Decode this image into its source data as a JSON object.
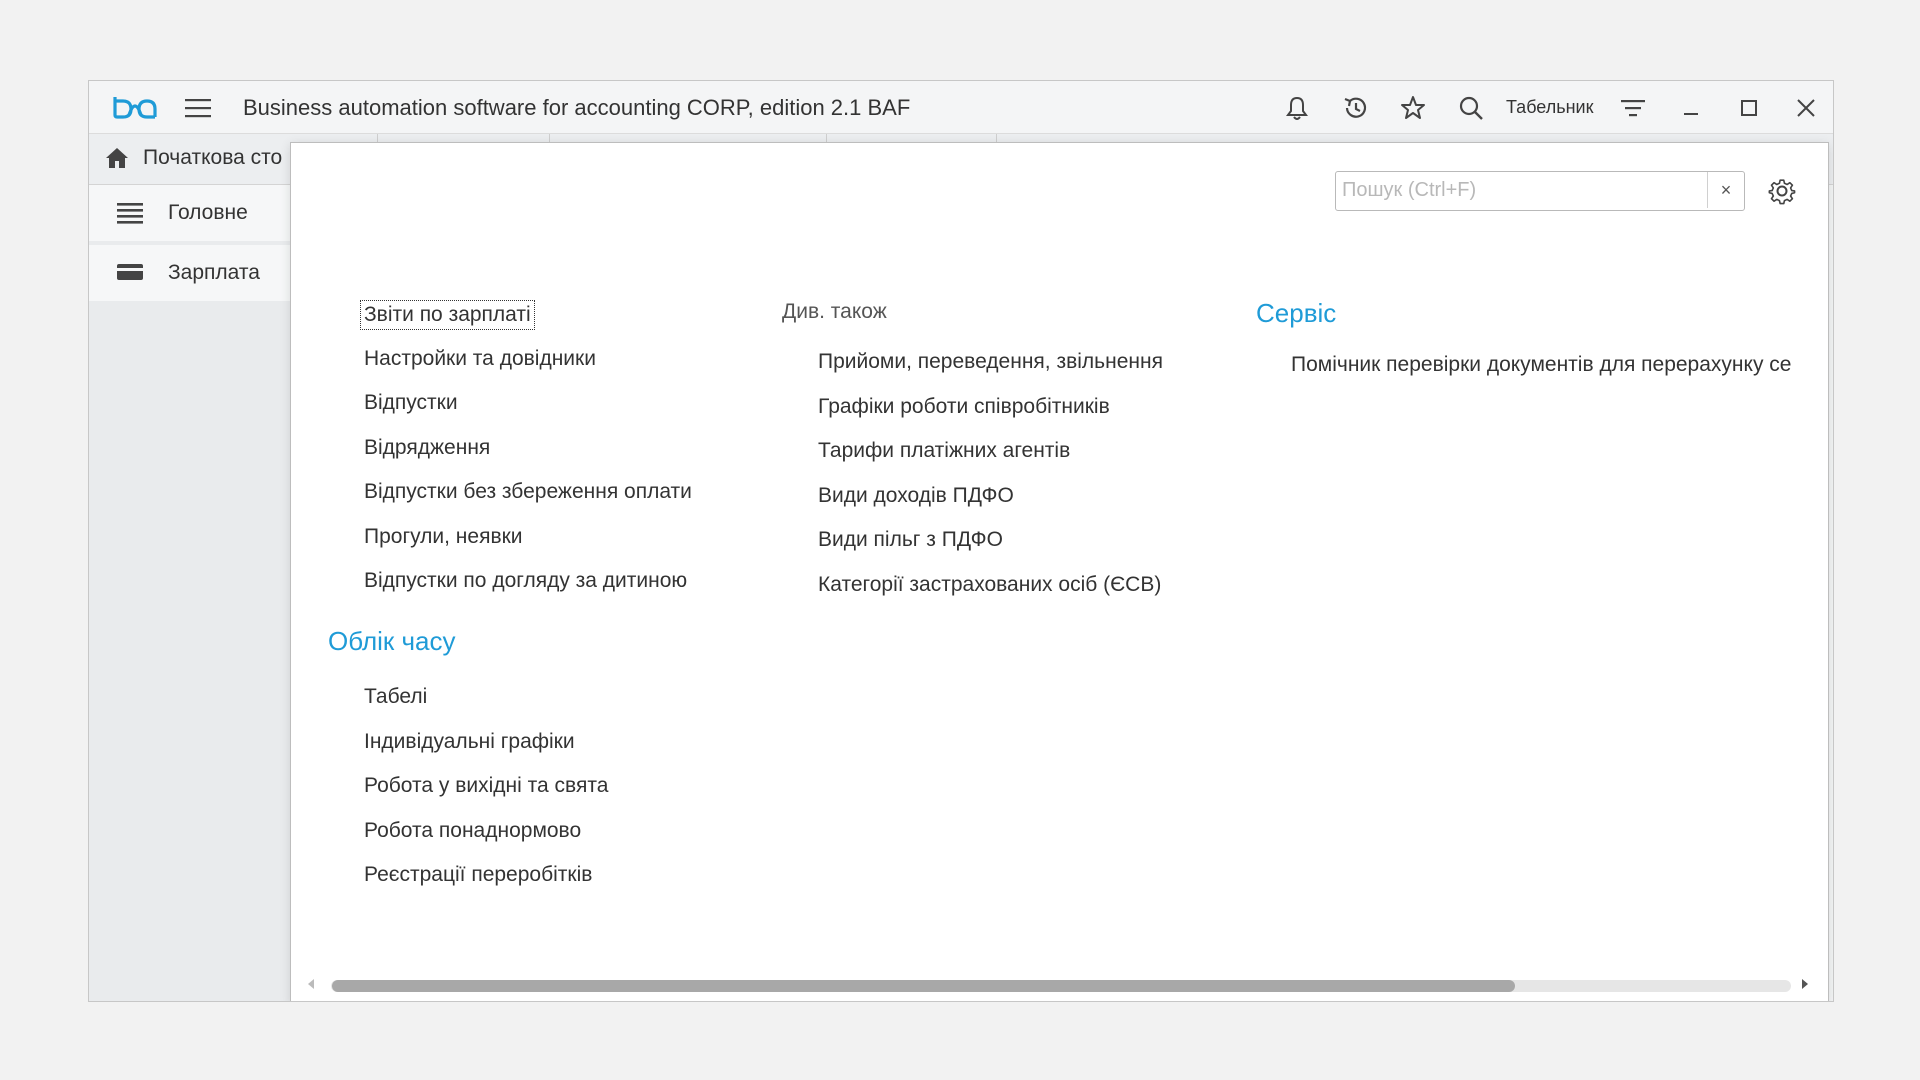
{
  "titlebar": {
    "app_title": "Business automation software for accounting CORP, edition 2.1 BAF",
    "user_name": "Табельник"
  },
  "tabs": {
    "home_label": "Початкова сто"
  },
  "sidebar": {
    "items": [
      {
        "label": "Головне",
        "icon": "list-icon"
      },
      {
        "label": "Зарплата",
        "icon": "wallet-icon"
      }
    ]
  },
  "panel": {
    "search_placeholder": "Пошук (Ctrl+F)",
    "search_value": "",
    "clear_label": "×",
    "close_label": "×",
    "col1": {
      "links": [
        "Звіти по зарплаті",
        "Настройки та довідники",
        "Відпустки",
        "Відрядження",
        "Відпустки без збереження оплати",
        "Прогули, неявки",
        "Відпустки по догляду за дитиною"
      ],
      "time_title": "Облік часу",
      "time_links": [
        "Табелі",
        "Індивідуальні графіки",
        "Робота у вихідні та свята",
        "Робота понаднормово",
        "Реєстрації переробітків"
      ]
    },
    "col2": {
      "title": "Див. також",
      "links": [
        "Прийоми, переведення, звільнення",
        "Графіки роботи співробітників",
        "Тарифи платіжних агентів",
        "Види доходів ПДФО",
        "Види пільг з ПДФО",
        "Категорії застрахованих осіб (ЄСВ)"
      ]
    },
    "col3": {
      "title": "Сервіс",
      "links": [
        "Помічник перевірки документів для перерахунку се"
      ]
    },
    "scroll_fraction": 0.81
  },
  "colors": {
    "accent": "#1f9bd7",
    "text": "#333333"
  }
}
